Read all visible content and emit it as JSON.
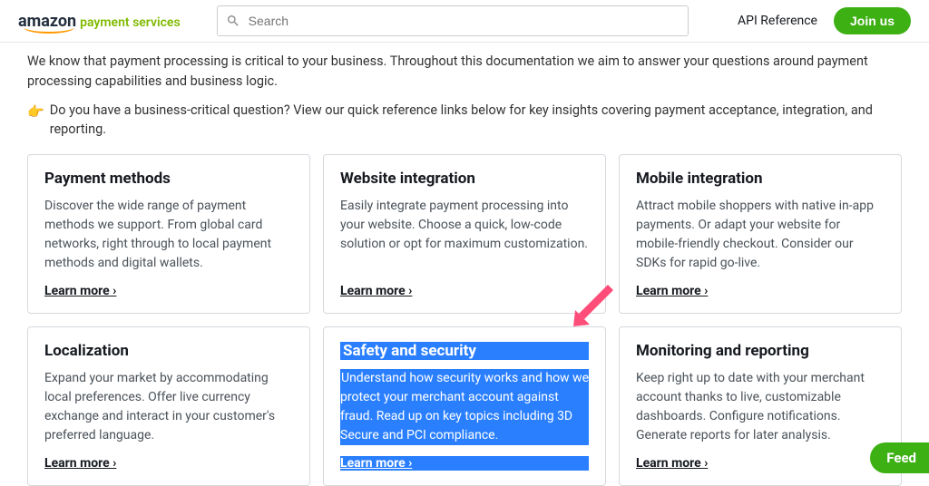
{
  "header": {
    "logo_amazon": "amazon",
    "logo_ps": "payment services",
    "search_placeholder": "Search",
    "api_link": "API Reference",
    "join_label": "Join us"
  },
  "intro": "We know that payment processing is critical to your business. Throughout this documentation we aim to answer your questions around payment processing capabilities and business logic.",
  "sub_intro": "Do you have a business-critical question? View our quick reference links below for key insights covering payment acceptance, integration, and reporting.",
  "cards": [
    {
      "title": "Payment methods",
      "desc": "Discover the wide range of payment methods we support. From global card networks, right through to local payment methods and digital wallets.",
      "cta": "Learn more ›"
    },
    {
      "title": "Website integration",
      "desc": "Easily integrate payment processing into your website. Choose a quick, low-code solution or opt for maximum customization.",
      "cta": "Learn more ›"
    },
    {
      "title": "Mobile integration",
      "desc": "Attract mobile shoppers with native in-app payments. Or adapt your website for mobile-friendly checkout. Consider our SDKs for rapid go-live.",
      "cta": "Learn more ›"
    },
    {
      "title": "Localization",
      "desc": "Expand your market by accommodating local preferences. Offer live currency exchange and interact in your customer's preferred language.",
      "cta": "Learn more ›"
    },
    {
      "title": "Safety and security",
      "desc": "Understand how security works and how we protect your merchant account against fraud. Read up on key topics including 3D Secure and PCI compliance.",
      "cta": "Learn more ›"
    },
    {
      "title": "Monitoring and reporting",
      "desc": "Keep right up to date with your merchant account thanks to live, customizable dashboards. Configure notifications. Generate reports for later analysis.",
      "cta": "Learn more ›"
    }
  ],
  "feed_tab": "Feed"
}
